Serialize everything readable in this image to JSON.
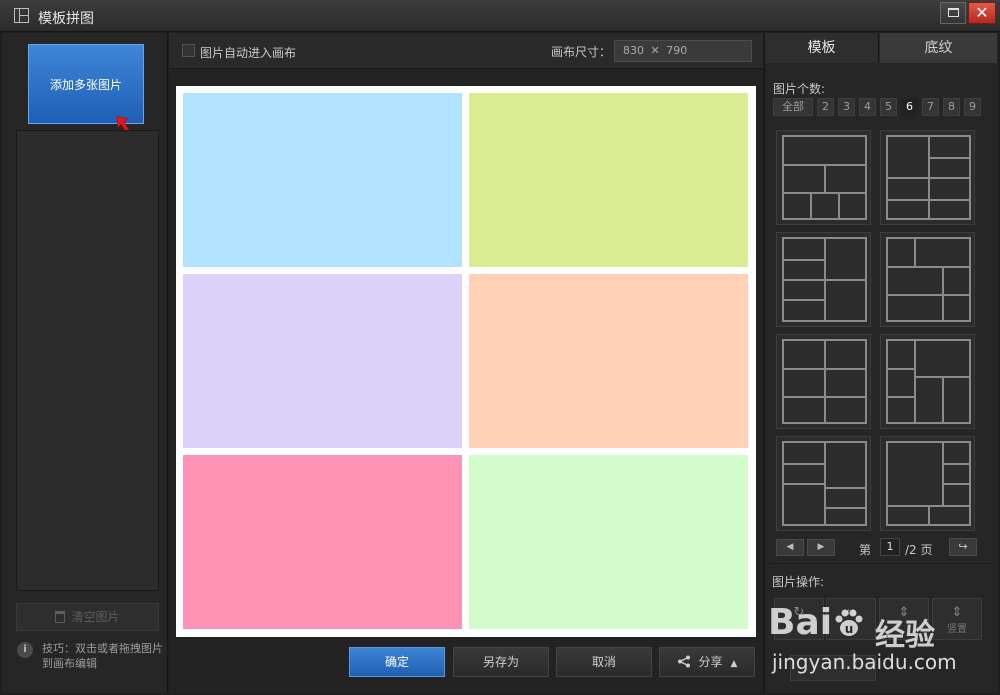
{
  "window": {
    "title": "模板拼图",
    "close_glyph": "✕"
  },
  "left": {
    "add_button": "添加多张图片",
    "clear_button": "清空图片",
    "tip": "技巧：双击或者拖拽图片到画布编辑",
    "info_glyph": "i"
  },
  "toolbar": {
    "auto_enter_label": "图片自动进入画布",
    "auto_enter_checked": false,
    "size_label": "画布尺寸：",
    "size_value": "830 ✕ 790"
  },
  "canvas": {
    "cells": [
      {
        "color": "#b1e3ff"
      },
      {
        "color": "#dbed93"
      },
      {
        "color": "#dcd2f9"
      },
      {
        "color": "#ffd1b7"
      },
      {
        "color": "#ff93b5"
      },
      {
        "color": "#d3fbcb"
      }
    ]
  },
  "bottom": {
    "ok": "确定",
    "save_as": "另存为",
    "cancel": "取消",
    "share": "分享",
    "share_caret": "▲",
    "share_icon": "share-icon"
  },
  "right": {
    "tabs": [
      {
        "label": "模板",
        "active": true
      },
      {
        "label": "底纹",
        "active": false
      }
    ],
    "count_label": "图片个数:",
    "counts": [
      {
        "label": "全部",
        "active": false
      },
      {
        "label": "2",
        "active": false
      },
      {
        "label": "3",
        "active": false
      },
      {
        "label": "4",
        "active": false
      },
      {
        "label": "5",
        "active": false
      },
      {
        "label": "6",
        "active": true
      },
      {
        "label": "7",
        "active": false
      },
      {
        "label": "8",
        "active": false
      },
      {
        "label": "9",
        "active": false
      }
    ],
    "pagination": {
      "prefix": "第",
      "current": "1",
      "total": "/2 页",
      "prev_glyph": "◀",
      "next_glyph": "▶",
      "go_glyph": "↪"
    },
    "ops_label": "图片操作:",
    "op_buttons": [
      {
        "glyph": "↻",
        "label": ""
      },
      {
        "glyph": "⇔",
        "label": ""
      },
      {
        "glyph": "⇕",
        "label": ""
      },
      {
        "glyph": "⇕",
        "label": "竖置"
      }
    ]
  },
  "watermark": {
    "logo_a": "Bai",
    "logo_b": "u",
    "cn": "经验",
    "url": "jingyan.baidu.com"
  }
}
